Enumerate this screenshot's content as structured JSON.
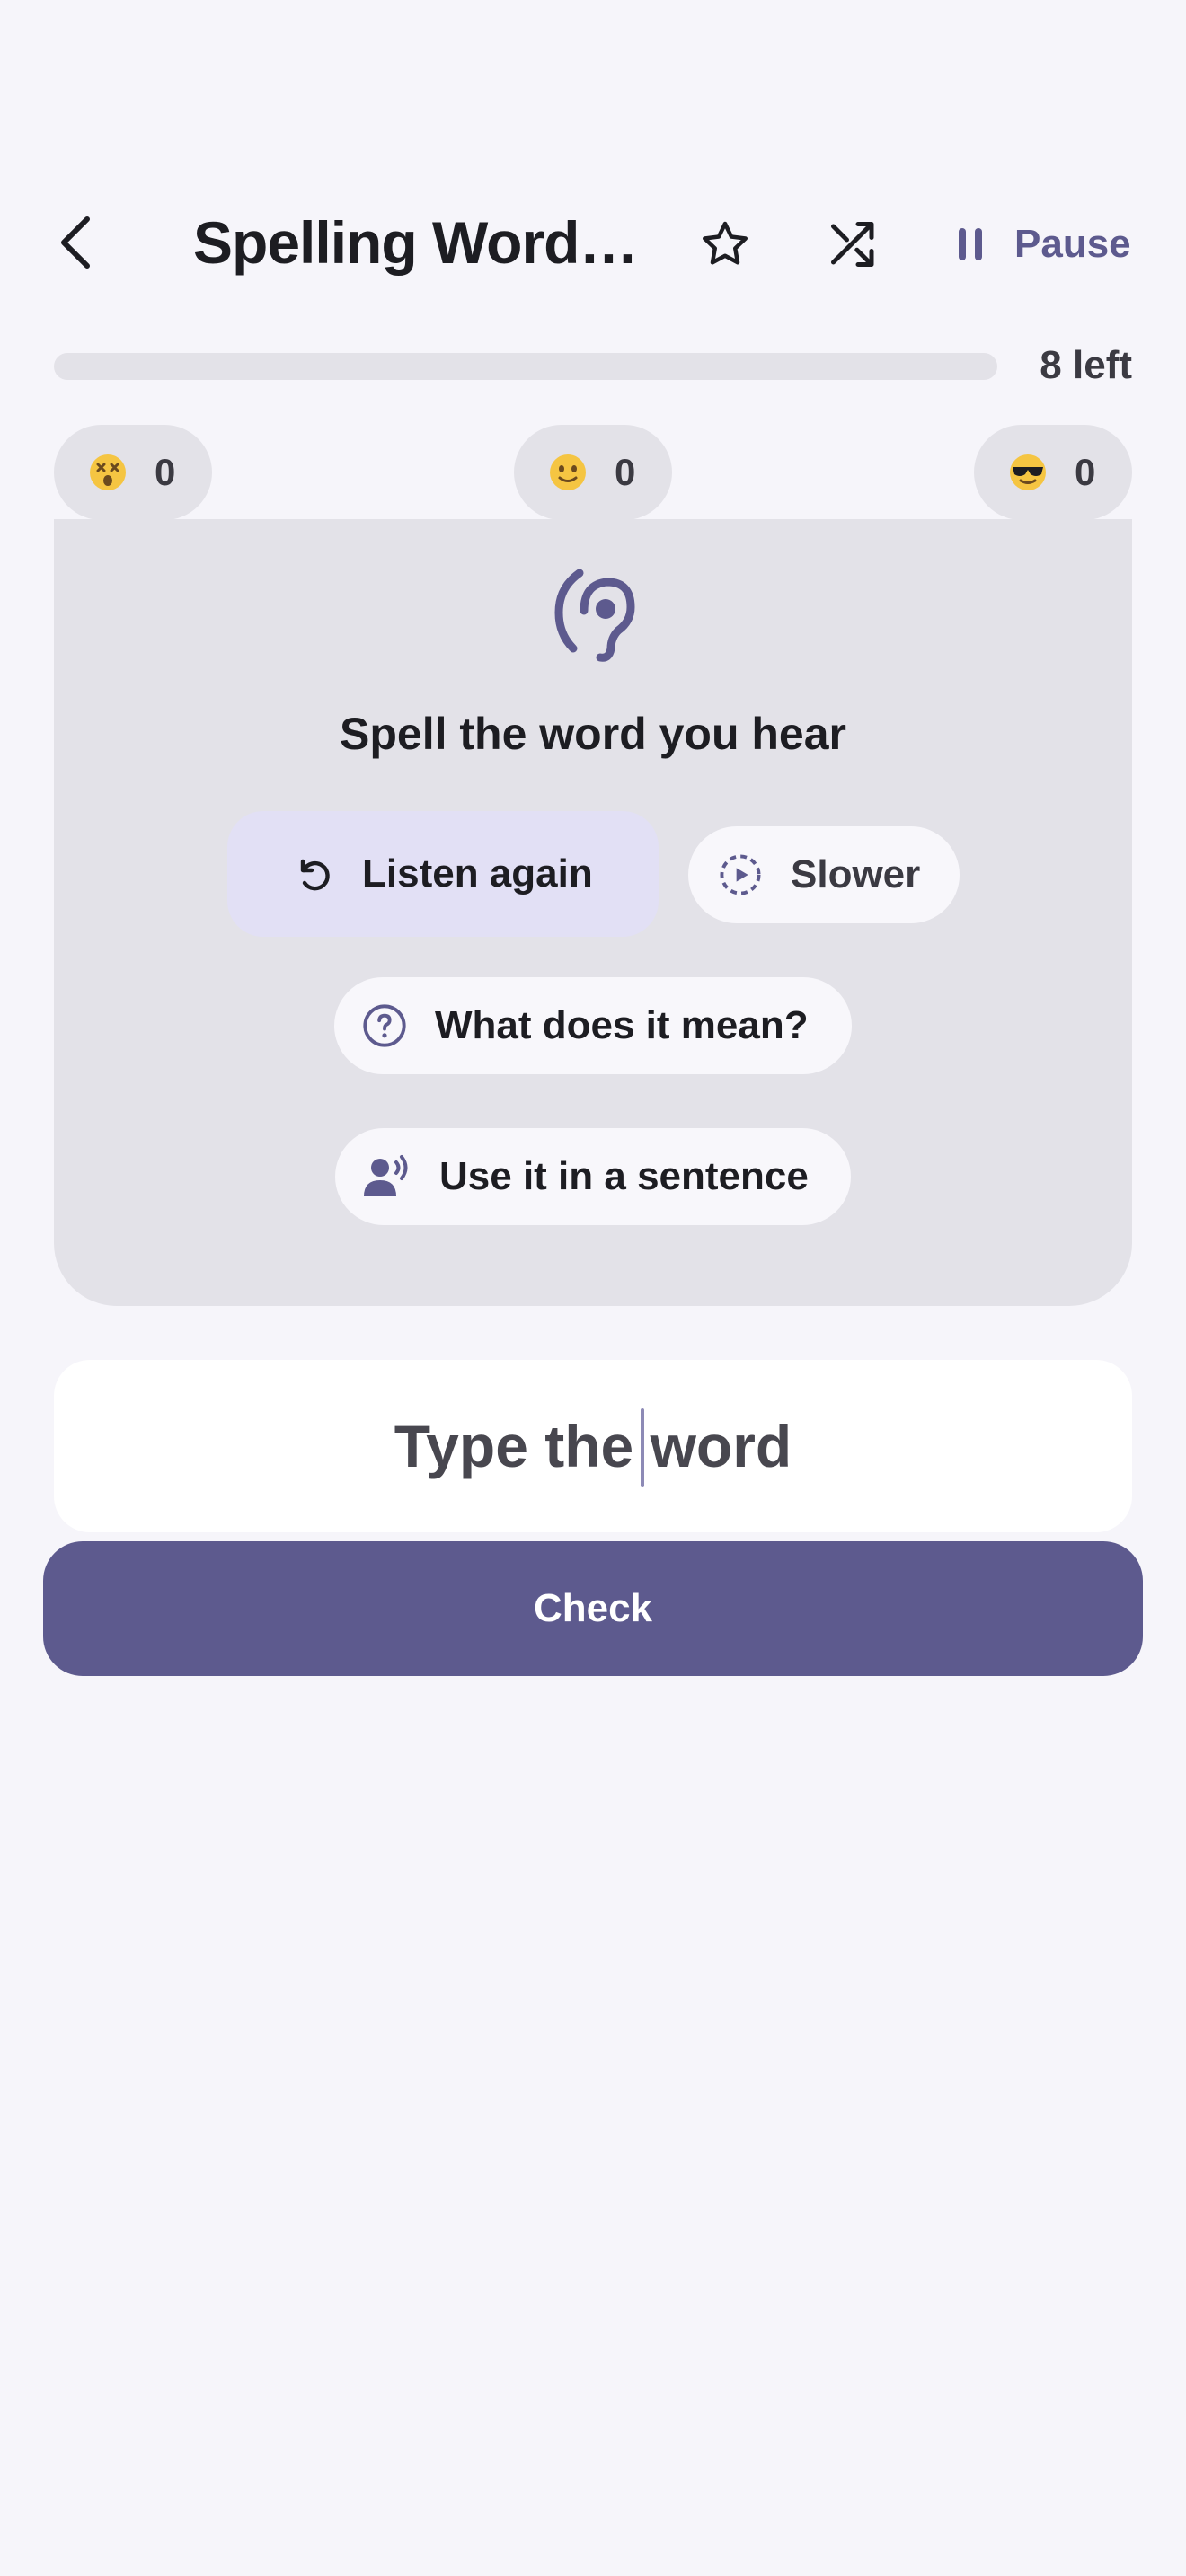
{
  "header": {
    "title": "Spelling Word…",
    "back_icon": "chevron-left-icon",
    "favorite_icon": "star-icon",
    "shuffle_icon": "shuffle-icon",
    "pause_label": "Pause",
    "pause_icon": "pause-icon"
  },
  "progress": {
    "left_label": "8 left",
    "fraction_complete": 0
  },
  "score_chips": [
    {
      "icon": "dizzy-face-emoji",
      "count": "0"
    },
    {
      "icon": "slightly-smiling-face-emoji",
      "count": "0"
    },
    {
      "icon": "sunglasses-face-emoji",
      "count": "0"
    }
  ],
  "card": {
    "icon": "ear-icon",
    "prompt": "Spell the word you hear",
    "listen_again_label": "Listen again",
    "slower_label": "Slower",
    "meaning_label": "What does it mean?",
    "sentence_label": "Use it in a sentence"
  },
  "answer": {
    "placeholder": "Type the word",
    "value": ""
  },
  "check_label": "Check",
  "colors": {
    "accent": "#5d5a8e",
    "background": "#f6f5fa",
    "card": "#e3e2e8",
    "primary_pill": "#e2e0f5"
  }
}
